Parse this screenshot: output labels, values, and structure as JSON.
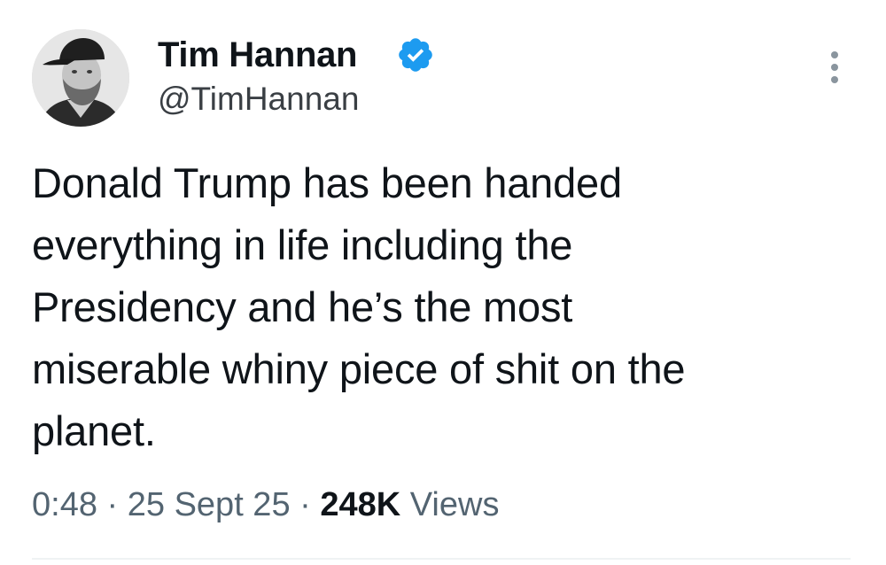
{
  "author": {
    "display_name": "Tim Hannan",
    "handle": "@TimHannan",
    "verified": true,
    "avatar_icon": "profile-avatar",
    "verified_icon": "verified-badge-icon",
    "verified_color": "#1d9bf0"
  },
  "tweet": {
    "text": "Donald Trump has been handed everything in life including the Presidency and he’s the most miserable whiny piece of shit on the planet.",
    "lines": [
      "Donald Trump has been handed",
      "everything in life including the",
      "Presidency and he’s the most",
      "miserable whiny piece of shit on the",
      "planet."
    ]
  },
  "meta": {
    "time": "0:48",
    "separator": "·",
    "date": "25 Sept 25",
    "views_count": "248K",
    "views_label": "Views"
  },
  "menu": {
    "icon": "more-options-icon"
  }
}
